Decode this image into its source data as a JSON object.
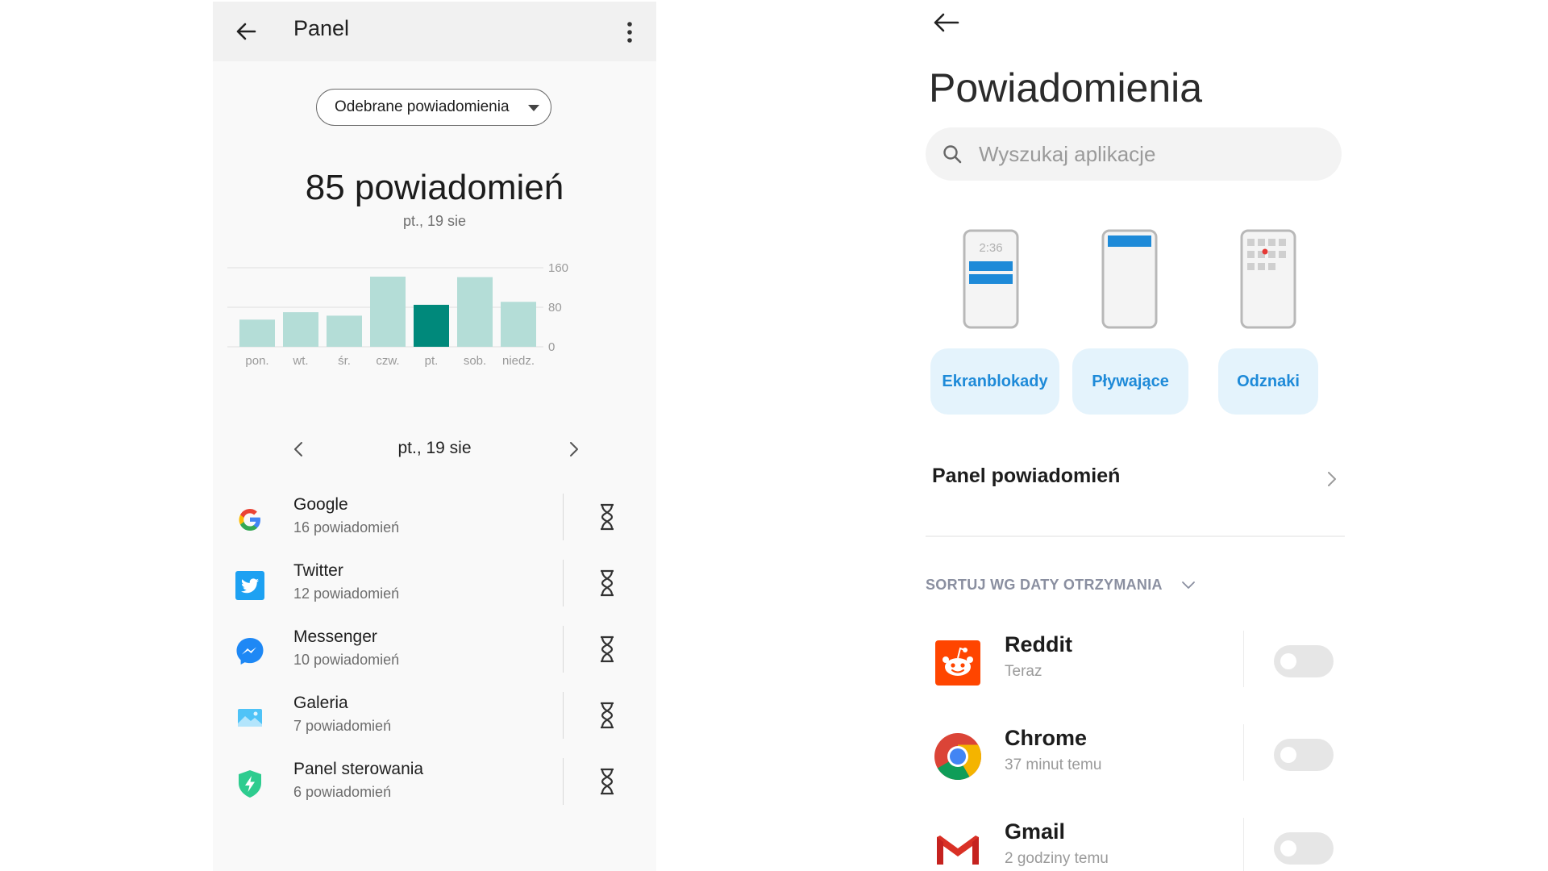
{
  "left_screen": {
    "title": "Panel",
    "dropdown": {
      "selected": "Odebrane powiadomienia"
    },
    "summary": {
      "count_text": "85 powiadomień",
      "date": "pt., 19 sie"
    },
    "date_nav": {
      "label": "pt., 19 sie"
    },
    "apps": [
      {
        "name": "Google",
        "count": "16 powiadomień",
        "icon": "google-icon"
      },
      {
        "name": "Twitter",
        "count": "12 powiadomień",
        "icon": "twitter-icon"
      },
      {
        "name": "Messenger",
        "count": "10 powiadomień",
        "icon": "messenger-icon"
      },
      {
        "name": "Galeria",
        "count": "7 powiadomień",
        "icon": "gallery-icon"
      },
      {
        "name": "Panel sterowania",
        "count": "6 powiadomień",
        "icon": "security-shield-icon"
      }
    ]
  },
  "chart_data": {
    "type": "bar",
    "categories": [
      "pon.",
      "wt.",
      "śr.",
      "czw.",
      "pt.",
      "sob.",
      "niedz."
    ],
    "values": [
      55,
      70,
      63,
      142,
      85,
      141,
      91
    ],
    "highlight_index": 4,
    "yticks": [
      "160",
      "80",
      "0"
    ],
    "ylim": [
      0,
      160
    ],
    "grid": true,
    "colors": {
      "bar": "#b4ddd7",
      "highlight": "#00897b",
      "grid": "#e4e4e4"
    }
  },
  "right_screen": {
    "title": "Powiadomienia",
    "search": {
      "placeholder": "Wyszukaj aplikacje"
    },
    "styles": [
      {
        "label": "Ekran blokady",
        "preview_time": "2:36"
      },
      {
        "label": "Pływające"
      },
      {
        "label": "Odznaki"
      }
    ],
    "panel_label": "Panel powiadomień",
    "sort_label": "SORTUJ WG DATY OTRZYMANIA",
    "notifications": [
      {
        "name": "Reddit",
        "time": "Teraz",
        "icon": "reddit-icon",
        "enabled": false
      },
      {
        "name": "Chrome",
        "time": "37 minut temu",
        "icon": "chrome-icon",
        "enabled": false
      },
      {
        "name": "Gmail",
        "time": "2 godziny temu",
        "icon": "gmail-icon",
        "enabled": false
      }
    ],
    "accent_color": "#1e8ad8"
  }
}
